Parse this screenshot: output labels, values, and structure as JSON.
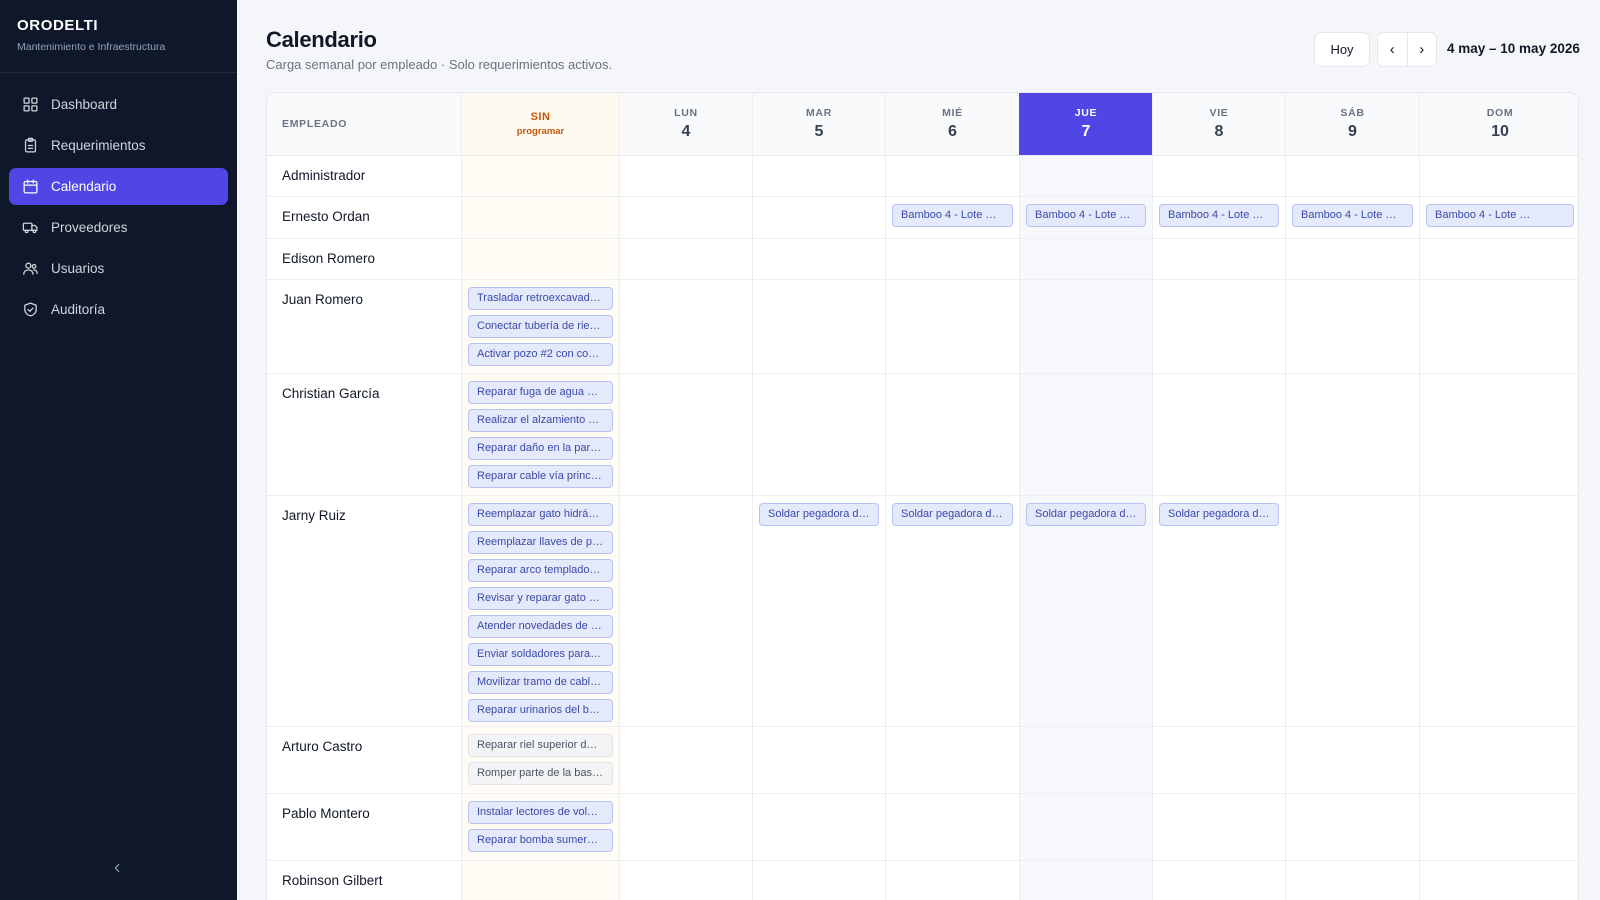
{
  "brand": {
    "name": "ORODELTI",
    "subtitle": "Mantenimiento e Infraestructura"
  },
  "sidebar": {
    "items": [
      {
        "label": "Dashboard",
        "icon": "grid-icon",
        "active": false
      },
      {
        "label": "Requerimientos",
        "icon": "clipboard-icon",
        "active": false
      },
      {
        "label": "Calendario",
        "icon": "calendar-icon",
        "active": true
      },
      {
        "label": "Proveedores",
        "icon": "truck-icon",
        "active": false
      },
      {
        "label": "Usuarios",
        "icon": "users-icon",
        "active": false
      },
      {
        "label": "Auditoría",
        "icon": "shield-check-icon",
        "active": false
      }
    ],
    "collapse_icon": "chevron-left-icon"
  },
  "header": {
    "title": "Calendario",
    "subtitle": "Carga semanal por empleado · Solo requerimientos activos.",
    "today_button": "Hoy",
    "prev_label": "‹",
    "next_label": "›",
    "range": "4 may – 10 may 2026"
  },
  "calendar": {
    "employee_header": "EMPLEADO",
    "unscheduled_header": "SIN",
    "unscheduled_sub": "programar",
    "days": [
      {
        "name": "LUN",
        "num": "4",
        "today": false
      },
      {
        "name": "MAR",
        "num": "5",
        "today": false
      },
      {
        "name": "MIÉ",
        "num": "6",
        "today": false
      },
      {
        "name": "JUE",
        "num": "7",
        "today": true
      },
      {
        "name": "VIE",
        "num": "8",
        "today": false
      },
      {
        "name": "SÁB",
        "num": "9",
        "today": false
      },
      {
        "name": "DOM",
        "num": "10",
        "today": false
      }
    ],
    "rows": [
      {
        "employee": "Administrador",
        "unscheduled": [],
        "days": [
          [],
          [],
          [],
          [],
          [],
          [],
          []
        ]
      },
      {
        "employee": "Ernesto Ordan",
        "unscheduled": [],
        "days": [
          [],
          [],
          [
            "Bamboo 4 - Lote …"
          ],
          [
            "Bamboo 4 - Lote …"
          ],
          [
            "Bamboo 4 - Lote …"
          ],
          [
            "Bamboo 4 - Lote …"
          ],
          [
            "Bamboo 4 - Lote …"
          ]
        ]
      },
      {
        "employee": "Edison Romero",
        "unscheduled": [],
        "days": [
          [],
          [],
          [],
          [],
          [],
          [],
          []
        ]
      },
      {
        "employee": "Juan Romero",
        "unscheduled": [
          "Trasladar retroexcavad…",
          "Conectar tubería de rie…",
          "Activar pozo #2 con co…"
        ],
        "days": [
          [],
          [],
          [],
          [],
          [],
          [],
          []
        ]
      },
      {
        "employee": "Christian García",
        "unscheduled": [
          "Reparar fuga de agua e…",
          "Realizar el alzamiento …",
          "Reparar daño en la par…",
          "Reparar cable vía princ…"
        ],
        "days": [
          [],
          [],
          [],
          [],
          [],
          [],
          []
        ]
      },
      {
        "employee": "Jarny Ruiz",
        "unscheduled": [
          "Reemplazar gato hidrá…",
          "Reemplazar llaves de p…",
          "Reparar arco templado…",
          "Revisar y reparar gato …",
          "Atender novedades de …",
          "Enviar soldadores para…",
          "Movilizar tramo de cabl…",
          "Reparar urinarios del b…"
        ],
        "days": [
          [],
          [
            "Soldar pegadora d…"
          ],
          [
            "Soldar pegadora d…"
          ],
          [
            "Soldar pegadora d…"
          ],
          [
            "Soldar pegadora d…"
          ],
          [],
          []
        ]
      },
      {
        "employee": "Arturo Castro",
        "unscheduled": [
          "Reparar riel superior d…",
          "Romper parte de la bas…"
        ],
        "unscheduled_style": "gray",
        "days": [
          [],
          [],
          [],
          [],
          [],
          [],
          []
        ]
      },
      {
        "employee": "Pablo Montero",
        "unscheduled": [
          "Instalar lectores de vol…",
          "Reparar bomba sumer…"
        ],
        "days": [
          [],
          [],
          [],
          [],
          [],
          [],
          []
        ]
      },
      {
        "employee": "Robinson Gilbert",
        "unscheduled": [],
        "days": [
          [],
          [],
          [],
          [],
          [],
          [],
          []
        ]
      }
    ]
  },
  "colors": {
    "sidebar_bg": "#0f172a",
    "accent": "#4f46e5",
    "unscheduled": "#c2570c",
    "chip_bg": "#e4e9fb",
    "chip_border": "#b6c2f2",
    "chip_text": "#3b4aa8"
  }
}
